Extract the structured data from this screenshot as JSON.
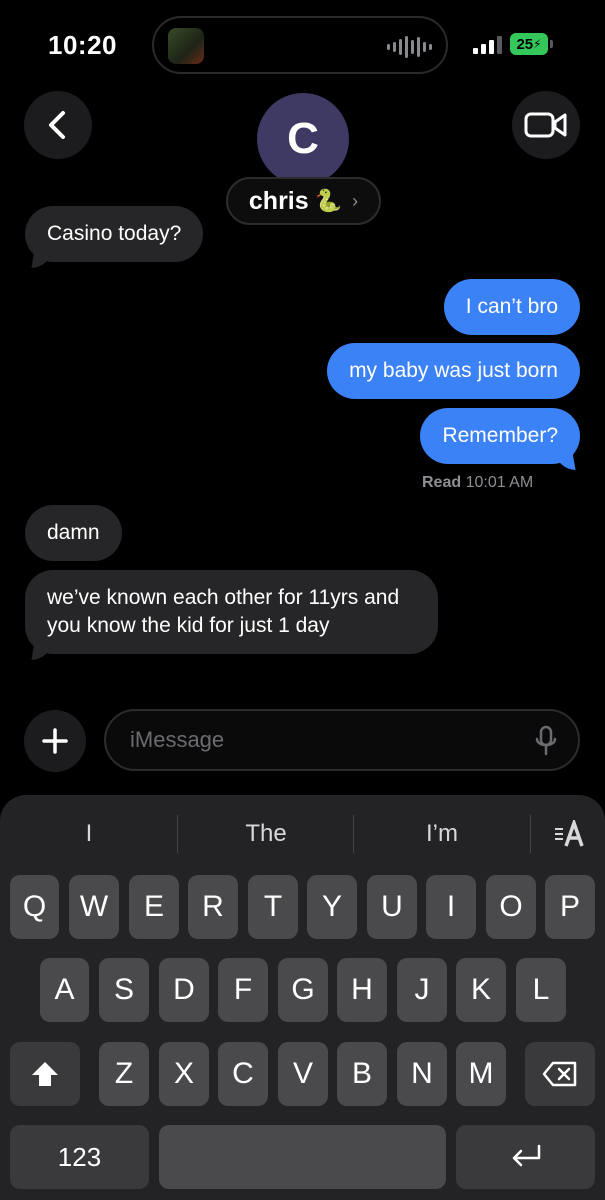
{
  "status_bar": {
    "time": "10:20",
    "battery": "25"
  },
  "header": {
    "avatar_initial": "C",
    "contact_name": "chris",
    "contact_emoji": "🐍"
  },
  "messages": [
    {
      "side": "in",
      "text": "Casino today?"
    },
    {
      "side": "out",
      "text": "I can’t bro"
    },
    {
      "side": "out",
      "text": "my baby was just born"
    },
    {
      "side": "out",
      "text": "Remember?"
    },
    {
      "side": "in",
      "text": "damn"
    },
    {
      "side": "in",
      "text": "we’ve known each other for 11yrs and you know the kid for just 1 day"
    }
  ],
  "read_receipt": {
    "label": "Read",
    "time": "10:01 AM"
  },
  "input": {
    "placeholder": "iMessage"
  },
  "keyboard": {
    "suggestions": [
      "I",
      "The",
      "I’m"
    ],
    "row1": [
      "Q",
      "W",
      "E",
      "R",
      "T",
      "Y",
      "U",
      "I",
      "O",
      "P"
    ],
    "row2": [
      "A",
      "S",
      "D",
      "F",
      "G",
      "H",
      "J",
      "K",
      "L"
    ],
    "row3": [
      "Z",
      "X",
      "C",
      "V",
      "B",
      "N",
      "M"
    ],
    "numbers_label": "123"
  },
  "colors": {
    "outgoing": "#3b82f6",
    "incoming": "#262628",
    "battery": "#34c759"
  }
}
